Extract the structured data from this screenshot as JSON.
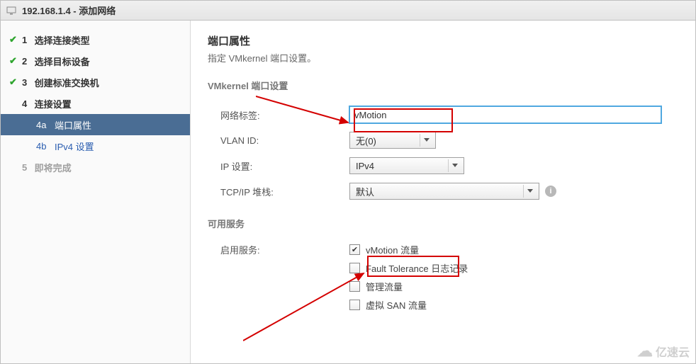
{
  "window": {
    "title": "192.168.1.4 - 添加网络"
  },
  "steps": {
    "s1": "选择连接类型",
    "s2": "选择目标设备",
    "s3": "创建标准交换机",
    "s4": "连接设置",
    "s4a_num": "4a",
    "s4a": "端口属性",
    "s4b_num": "4b",
    "s4b": "IPv4 设置",
    "s5": "即将完成"
  },
  "content": {
    "heading": "端口属性",
    "desc": "指定 VMkernel 端口设置。",
    "section1": "VMkernel 端口设置",
    "label_net": "网络标签:",
    "value_net": "vMotion",
    "label_vlan": "VLAN ID:",
    "value_vlan": "无(0)",
    "label_ip": "IP 设置:",
    "value_ip": "IPv4",
    "label_stack": "TCP/IP 堆栈:",
    "value_stack": "默认",
    "section2": "可用服务",
    "label_enable": "启用服务:",
    "svc_vmotion": "vMotion 流量",
    "svc_ft": "Fault Tolerance 日志记录",
    "svc_mgmt": "管理流量",
    "svc_vsan": "虚拟 SAN 流量"
  },
  "watermark": "亿速云"
}
